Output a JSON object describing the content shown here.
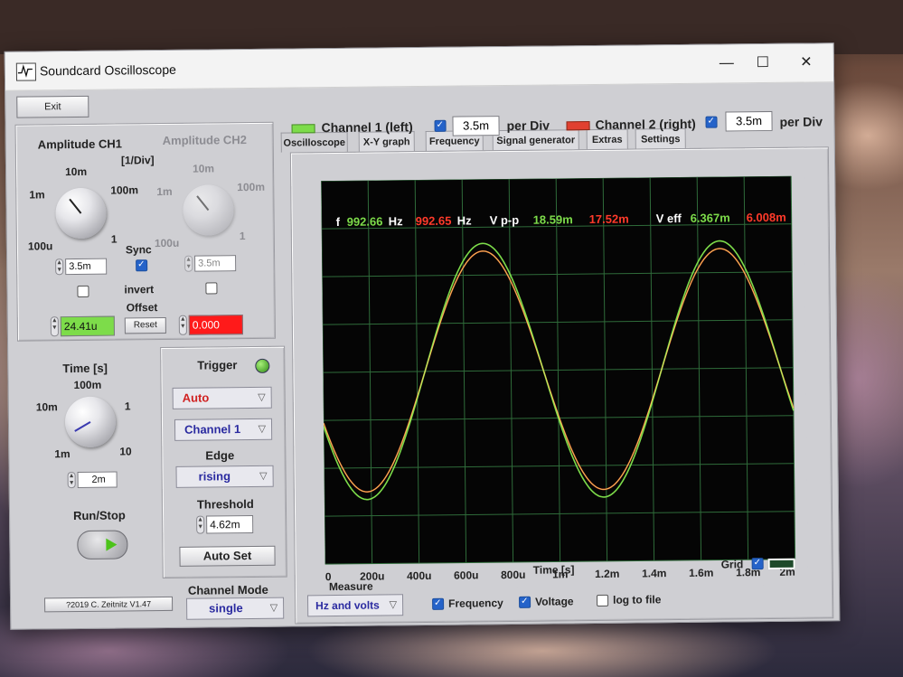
{
  "window": {
    "title": "Soundcard Oscilloscope"
  },
  "window_controls": {
    "minimize": "—",
    "maximize": "☐",
    "close": "✕"
  },
  "left": {
    "exit_label": "Exit",
    "amp_ch1_title": "Amplitude CH1",
    "amp_ch2_title": "Amplitude CH2",
    "div_unit": "[1/Div]",
    "knob_ch1_labels": [
      "10m",
      "1m",
      "100m",
      "100u",
      "1"
    ],
    "knob_ch2_labels": [
      "10m",
      "1m",
      "100m",
      "100u",
      "1"
    ],
    "ch1_value": "3.5m",
    "ch2_value": "3.5m",
    "sync_label": "Sync",
    "sync_checked": true,
    "invert_label": "invert",
    "offset_label": "Offset",
    "reset_label": "Reset",
    "offset_ch1": "24.41u",
    "offset_ch2": "0.000",
    "time_title": "Time [s]",
    "time_knob_labels": [
      "100m",
      "10m",
      "1",
      "1m",
      "10"
    ],
    "time_value": "2m",
    "runstop_label": "Run/Stop",
    "copyright": "?2019  C. Zeitnitz V1.47"
  },
  "trigger": {
    "title": "Trigger",
    "mode": "Auto",
    "channel": "Channel 1",
    "edge_label": "Edge",
    "edge": "rising",
    "threshold_label": "Threshold",
    "threshold": "4.62m",
    "autoset_label": "Auto Set"
  },
  "channel_mode": {
    "label": "Channel Mode",
    "value": "single"
  },
  "tabs": [
    "Oscilloscope",
    "X-Y graph",
    "Frequency",
    "Signal generator",
    "Extras",
    "Settings"
  ],
  "channels_bar": {
    "ch1_label": "Channel 1 (left)",
    "ch1_value": "3.5m",
    "ch2_label": "Channel 2 (right)",
    "ch2_value": "3.5m",
    "per_div": "per Div"
  },
  "readouts": {
    "f_label": "f",
    "f_ch1": "992.66",
    "f_unit1": "Hz",
    "f_ch2": "992.65",
    "f_unit2": "Hz",
    "vpp_label": "V p-p",
    "vpp_ch1": "18.59m",
    "vpp_ch2": "17.52m",
    "veff_label": "V eff",
    "veff_ch1": "6.367m",
    "veff_ch2": "6.008m"
  },
  "measure": {
    "label": "Measure",
    "mode": "Hz and volts",
    "frequency_label": "Frequency",
    "frequency_checked": true,
    "voltage_label": "Voltage",
    "voltage_checked": true,
    "log_label": "log to file",
    "log_checked": false
  },
  "grid_label": "Grid",
  "colors": {
    "ch1": "#7ddc4a",
    "ch2": "#e04030",
    "trace_combined": "#f2e060",
    "screen_bg": "#050505",
    "grid": "#2f6b3a",
    "offset_ch1_bg": "#7ddc4a",
    "offset_ch2_bg": "#ff1a1a"
  },
  "chart_data": {
    "type": "line",
    "xlabel": "Time [s]",
    "ylabel": "",
    "x_ticks": [
      "0",
      "200u",
      "400u",
      "600u",
      "800u",
      "1m",
      "1.2m",
      "1.4m",
      "1.6m",
      "1.8m",
      "2m"
    ],
    "xlim": [
      0,
      0.002
    ],
    "ylim": [
      -4,
      4
    ],
    "y_unit": "div",
    "grid": true,
    "series": [
      {
        "name": "Channel 1 (left)",
        "frequency_hz": 992.66,
        "amplitude_div": 2.66,
        "phase_deg": 205,
        "color": "#7ddc4a"
      },
      {
        "name": "Channel 2 (right)",
        "frequency_hz": 992.65,
        "amplitude_div": 2.5,
        "phase_deg": 205,
        "color": "#e04030"
      }
    ]
  }
}
